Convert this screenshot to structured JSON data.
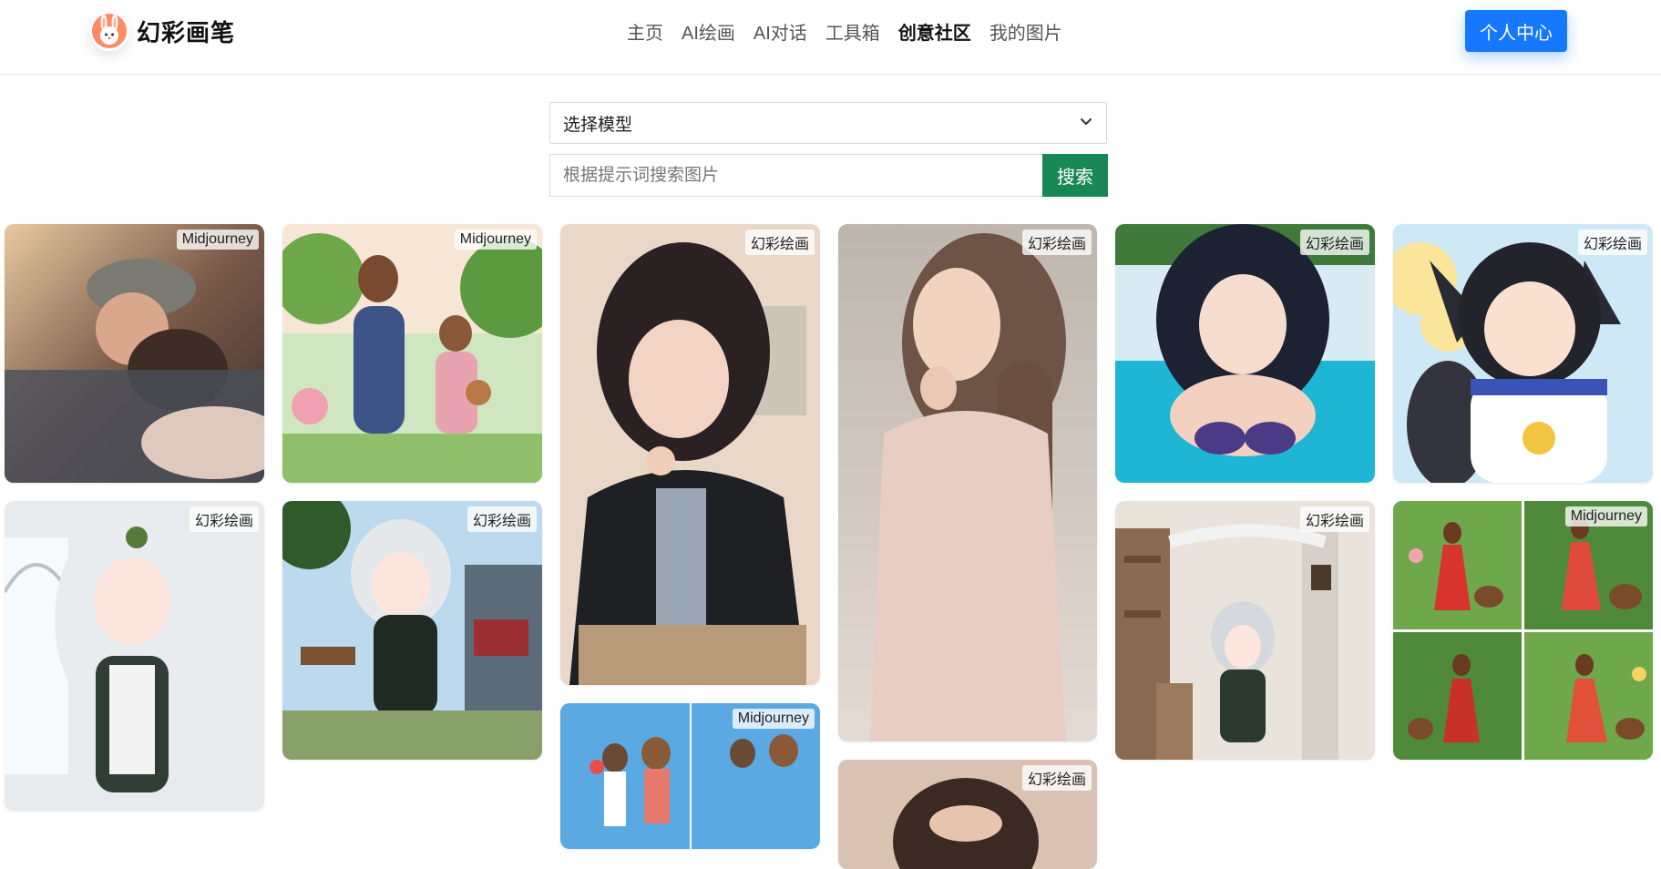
{
  "header": {
    "brand_name": "幻彩画笔",
    "logo_icon": "rabbit-logo-icon",
    "nav": [
      {
        "label": "主页",
        "active": false
      },
      {
        "label": "AI绘画",
        "active": false
      },
      {
        "label": "AI对话",
        "active": false
      },
      {
        "label": "工具箱",
        "active": false
      },
      {
        "label": "创意社区",
        "active": true
      },
      {
        "label": "我的图片",
        "active": false
      }
    ],
    "profile_button": "个人中心"
  },
  "search": {
    "model_select_value": "选择模型",
    "select_icon": "chevron-down-icon",
    "placeholder": "根据提示词搜索图片",
    "button": "搜索"
  },
  "gallery": {
    "cards": [
      {
        "tag": "Midjourney",
        "subject": "couple-sleeping"
      },
      {
        "tag": "Midjourney",
        "subject": "mother-daughter-walk"
      },
      {
        "tag": "幻彩绘画",
        "subject": "anime-girl-desk"
      },
      {
        "tag": "幻彩绘画",
        "subject": "portrait-pink-dress"
      },
      {
        "tag": "幻彩绘画",
        "subject": "anime-girl-pool"
      },
      {
        "tag": "幻彩绘画",
        "subject": "wolf-ear-girl"
      },
      {
        "tag": "幻彩绘画",
        "subject": "white-hair-elf-window"
      },
      {
        "tag": "幻彩绘画",
        "subject": "white-hair-elf-street"
      },
      {
        "tag": "Midjourney",
        "subject": "couple-flowers"
      },
      {
        "tag": "幻彩绘画",
        "subject": "partial-portrait"
      },
      {
        "tag": "幻彩绘画",
        "subject": "elf-room"
      },
      {
        "tag": "Midjourney",
        "subject": "red-dress-dogs-grid"
      }
    ]
  },
  "colors": {
    "primary": "#1677ff",
    "search_button": "#198754",
    "border": "#d9d9d9"
  }
}
